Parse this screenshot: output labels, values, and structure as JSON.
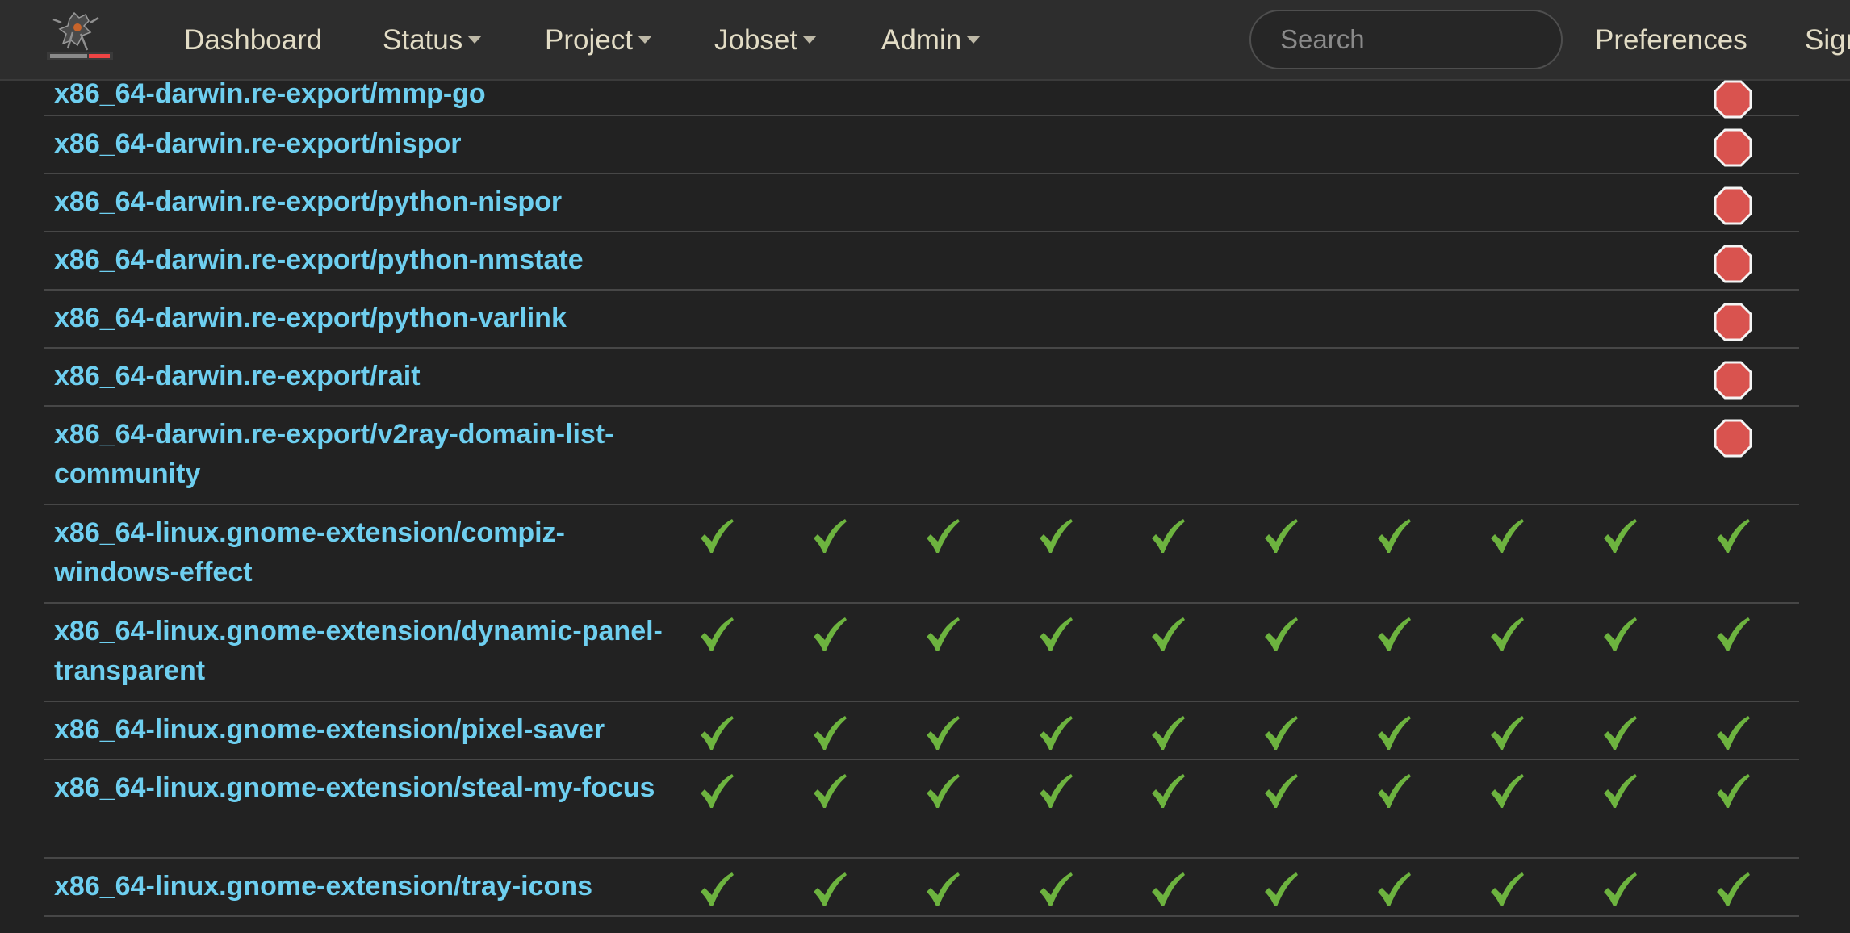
{
  "navbar": {
    "logo_text": "Hydra",
    "items": [
      {
        "label": "Dashboard",
        "dropdown": false
      },
      {
        "label": "Status",
        "dropdown": true
      },
      {
        "label": "Project",
        "dropdown": true
      },
      {
        "label": "Jobset",
        "dropdown": true
      },
      {
        "label": "Admin",
        "dropdown": true
      }
    ],
    "search_placeholder": "Search",
    "preferences_label": "Preferences",
    "signin_label": "Sign in"
  },
  "colors": {
    "link": "#6ecff0",
    "success": "#6db33f",
    "failure": "#d9534f",
    "background": "#222222",
    "navbar": "#2d2d2d"
  },
  "status_icons": {
    "success": "checkmark-icon",
    "failure": "stop-octagon-icon"
  },
  "jobs": [
    {
      "name": "x86_64-darwin.re-export/mmp-go",
      "statuses": [
        "failure"
      ]
    },
    {
      "name": "x86_64-darwin.re-export/nispor",
      "statuses": [
        "failure"
      ]
    },
    {
      "name": "x86_64-darwin.re-export/python-nispor",
      "statuses": [
        "failure"
      ]
    },
    {
      "name": "x86_64-darwin.re-export/python-nmstate",
      "statuses": [
        "failure"
      ]
    },
    {
      "name": "x86_64-darwin.re-export/python-varlink",
      "statuses": [
        "failure"
      ]
    },
    {
      "name": "x86_64-darwin.re-export/rait",
      "statuses": [
        "failure"
      ]
    },
    {
      "name": "x86_64-darwin.re-export/v2ray-domain-list-community",
      "statuses": [
        "failure"
      ]
    },
    {
      "name": "x86_64-linux.gnome-extension/compiz-windows-effect",
      "statuses": [
        "success",
        "success",
        "success",
        "success",
        "success",
        "success",
        "success",
        "success",
        "success",
        "success"
      ]
    },
    {
      "name": "x86_64-linux.gnome-extension/dynamic-panel-transparent",
      "statuses": [
        "success",
        "success",
        "success",
        "success",
        "success",
        "success",
        "success",
        "success",
        "success",
        "success"
      ]
    },
    {
      "name": "x86_64-linux.gnome-extension/pixel-saver",
      "statuses": [
        "success",
        "success",
        "success",
        "success",
        "success",
        "success",
        "success",
        "success",
        "success",
        "success"
      ]
    },
    {
      "name": "x86_64-linux.gnome-extension/steal-my-focus",
      "statuses": [
        "success",
        "success",
        "success",
        "success",
        "success",
        "success",
        "success",
        "success",
        "success",
        "success"
      ]
    },
    {
      "name": "x86_64-linux.gnome-extension/tray-icons",
      "statuses": [
        "success",
        "success",
        "success",
        "success",
        "success",
        "success",
        "success",
        "success",
        "success",
        "success"
      ]
    }
  ]
}
